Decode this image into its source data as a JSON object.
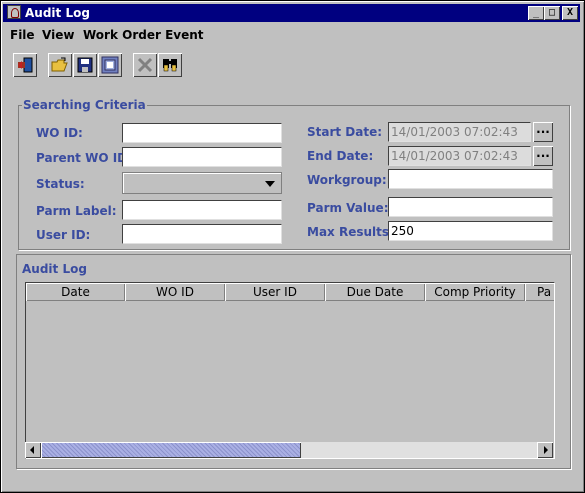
{
  "window": {
    "title": "Audit Log",
    "controls": [
      "_",
      "□",
      "X"
    ]
  },
  "menu": {
    "file": "File",
    "view": "View",
    "work_order_event": "Work Order Event"
  },
  "toolbar": {
    "icons": [
      "exit-icon",
      "open-folder-icon",
      "save-icon",
      "print-icon",
      "delete-icon",
      "find-icon"
    ]
  },
  "criteria": {
    "title": "Searching Criteria",
    "wo_id_label": "WO ID:",
    "wo_id_value": "",
    "parent_wo_id_label": "Parent WO ID:",
    "parent_wo_id_value": "",
    "status_label": "Status:",
    "status_value": "",
    "parm_label_label": "Parm Label:",
    "parm_label_value": "",
    "user_id_label": "User ID:",
    "user_id_value": "",
    "start_date_label": "Start Date:",
    "start_date_value": "14/01/2003 07:02:43",
    "end_date_label": "End Date:",
    "end_date_value": "14/01/2003 07:02:43",
    "workgroup_label": "Workgroup:",
    "workgroup_value": "",
    "parm_value_label": "Parm Value:",
    "parm_value_value": "",
    "max_results_label": "Max Results:",
    "max_results_value": "250",
    "browse_label": "..."
  },
  "audit_log": {
    "title": "Audit Log",
    "columns": [
      "Date",
      "WO ID",
      "User ID",
      "Due Date",
      "Comp Priority",
      "Pa"
    ]
  }
}
